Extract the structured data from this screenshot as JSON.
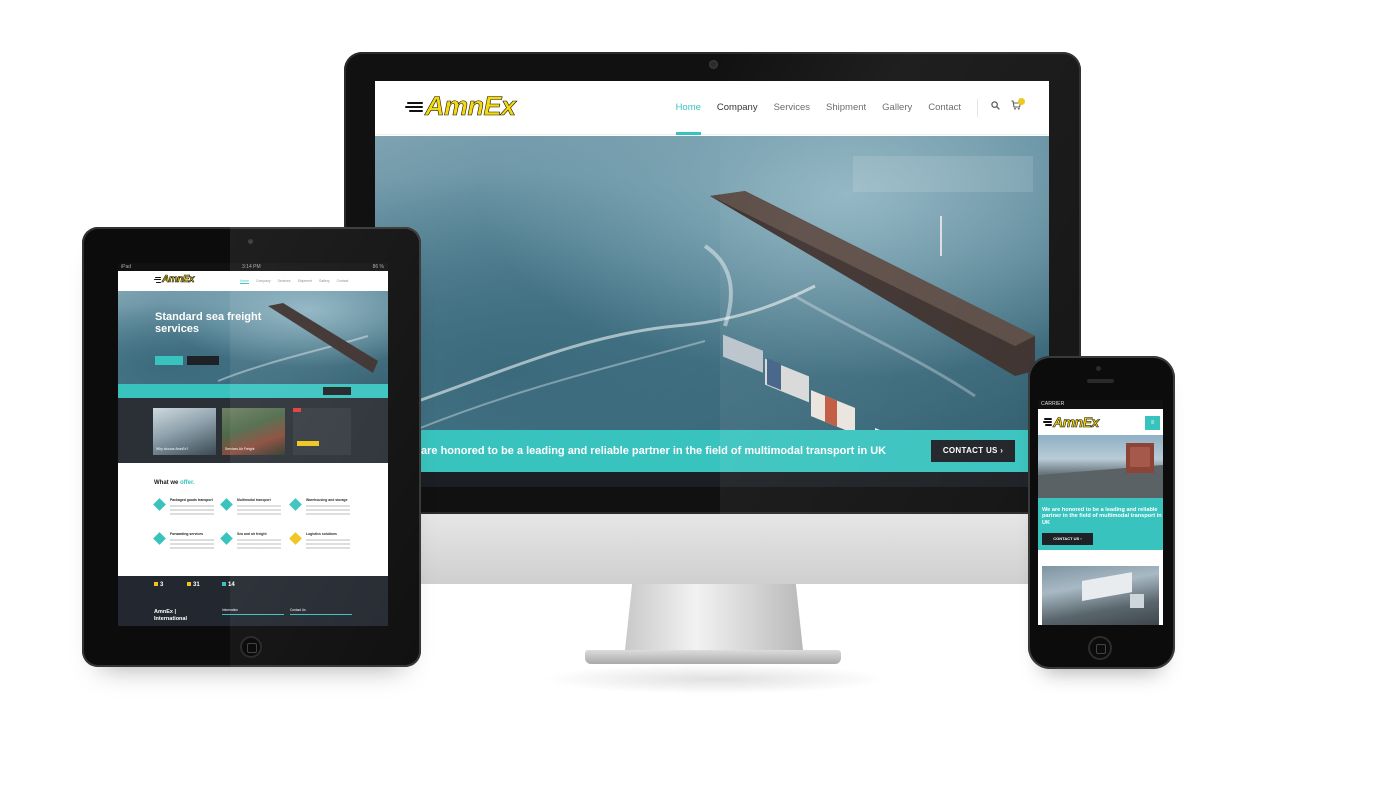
{
  "brand": {
    "logo_text": "AmnEx"
  },
  "desktop": {
    "nav": {
      "items": [
        {
          "label": "Home",
          "state": "active"
        },
        {
          "label": "Company",
          "state": "hover"
        },
        {
          "label": "Services",
          "state": ""
        },
        {
          "label": "Shipment",
          "state": ""
        },
        {
          "label": "Gallery",
          "state": ""
        },
        {
          "label": "Contact",
          "state": ""
        }
      ],
      "icons": [
        "search-icon",
        "cart-icon"
      ]
    },
    "band": {
      "text": "are honored to be a leading and reliable partner in the field of multimodal transport in UK",
      "cta": "CONTACT US"
    }
  },
  "tablet": {
    "status": {
      "carrier": "iPad",
      "time": "3:14 PM",
      "battery": "86 %"
    },
    "hero": {
      "title": "Standard sea freight services"
    },
    "cards": [
      {
        "label": "Why choose AmnEx?"
      },
      {
        "label": "Services Air Freight"
      }
    ],
    "offer": {
      "title_main": "What we",
      "title_accent": "offer."
    },
    "services": [
      {
        "title": "Packaged goods transport",
        "icon": "diamond-icon"
      },
      {
        "title": "Multimodal transport",
        "icon": "diamond-icon"
      },
      {
        "title": "Warehousing and storage",
        "icon": "diamond-icon"
      },
      {
        "title": "Forwarding services",
        "icon": "diamond-icon"
      },
      {
        "title": "Sea and air freight",
        "icon": "diamond-icon"
      },
      {
        "title": "Logistics solutions",
        "icon": "diamond-icon-yellow"
      }
    ],
    "stats": [
      {
        "value": "3"
      },
      {
        "value": "31"
      },
      {
        "value": "14"
      }
    ],
    "footer": {
      "brand": "AmnEx | International",
      "col1": "Information",
      "col2": "Contact Us"
    }
  },
  "phone": {
    "status": {
      "carrier": "CARRIER"
    },
    "band": {
      "text": "We are honored to be a leading and reliable partner in the field of multimodal transport in UK",
      "cta": "CONTACT US"
    }
  },
  "colors": {
    "accent": "#39c3bf",
    "dark": "#1e2226",
    "logo_yellow": "#f5d90a"
  }
}
